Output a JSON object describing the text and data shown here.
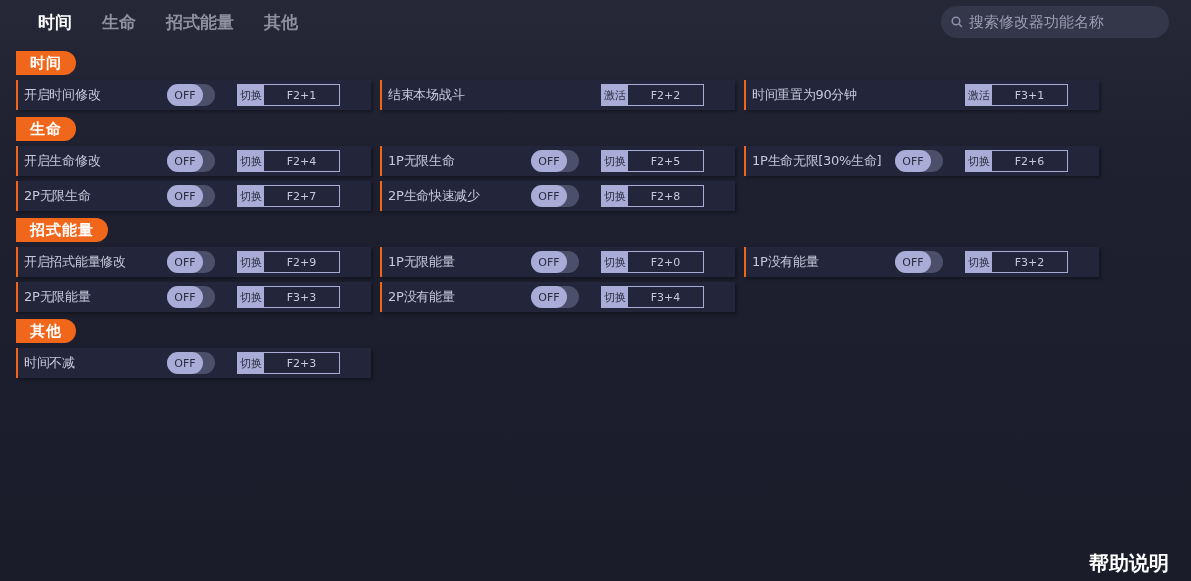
{
  "tabs": [
    {
      "label": "时间",
      "selected": true
    },
    {
      "label": "生命",
      "selected": false
    },
    {
      "label": "招式能量",
      "selected": false
    },
    {
      "label": "其他",
      "selected": false
    }
  ],
  "search": {
    "placeholder": "搜索修改器功能名称"
  },
  "sections": [
    {
      "title": "时间",
      "items": [
        {
          "kind": "toggle",
          "name": "开启时间修改",
          "on": false,
          "switch_label": "OFF",
          "action": "切换",
          "hotkey": "F2+1"
        },
        {
          "kind": "button",
          "name": "结束本场战斗",
          "action": "激活",
          "hotkey": "F2+2"
        },
        {
          "kind": "button",
          "name": "时间重置为90分钟",
          "action": "激活",
          "hotkey": "F3+1"
        }
      ]
    },
    {
      "title": "生命",
      "items": [
        {
          "kind": "toggle",
          "name": "开启生命修改",
          "on": false,
          "switch_label": "OFF",
          "action": "切换",
          "hotkey": "F2+4"
        },
        {
          "kind": "toggle",
          "name": "1P无限生命",
          "on": false,
          "switch_label": "OFF",
          "action": "切换",
          "hotkey": "F2+5"
        },
        {
          "kind": "toggle",
          "name": "1P生命无限[30%生命]",
          "on": false,
          "switch_label": "OFF",
          "action": "切换",
          "hotkey": "F2+6"
        },
        {
          "kind": "toggle",
          "name": "2P无限生命",
          "on": false,
          "switch_label": "OFF",
          "action": "切换",
          "hotkey": "F2+7"
        },
        {
          "kind": "toggle",
          "name": "2P生命快速减少",
          "on": false,
          "switch_label": "OFF",
          "action": "切换",
          "hotkey": "F2+8"
        }
      ]
    },
    {
      "title": "招式能量",
      "items": [
        {
          "kind": "toggle",
          "name": "开启招式能量修改",
          "on": false,
          "switch_label": "OFF",
          "action": "切换",
          "hotkey": "F2+9"
        },
        {
          "kind": "toggle",
          "name": "1P无限能量",
          "on": false,
          "switch_label": "OFF",
          "action": "切换",
          "hotkey": "F2+0"
        },
        {
          "kind": "toggle",
          "name": "1P没有能量",
          "on": false,
          "switch_label": "OFF",
          "action": "切换",
          "hotkey": "F3+2"
        },
        {
          "kind": "toggle",
          "name": "2P无限能量",
          "on": false,
          "switch_label": "OFF",
          "action": "切换",
          "hotkey": "F3+3"
        },
        {
          "kind": "toggle",
          "name": "2P没有能量",
          "on": false,
          "switch_label": "OFF",
          "action": "切换",
          "hotkey": "F3+4"
        }
      ]
    },
    {
      "title": "其他",
      "items": [
        {
          "kind": "toggle",
          "name": "时间不减",
          "on": false,
          "switch_label": "OFF",
          "action": "切换",
          "hotkey": "F2+3"
        }
      ]
    }
  ],
  "help": "帮助说明"
}
